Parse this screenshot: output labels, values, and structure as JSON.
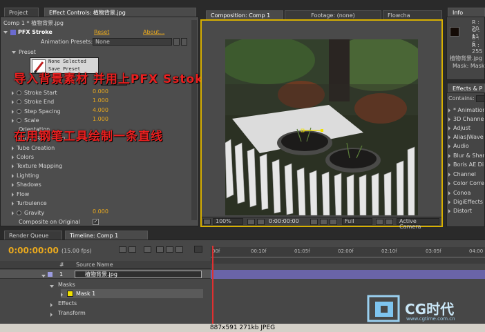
{
  "left_panel": {
    "tabs": [
      "Project",
      "Effect Controls: 植物背景.jpg"
    ],
    "comp_line": "Comp 1 * 植物背景.jpg",
    "effect_name": "PFX Stroke",
    "reset_label": "Reset",
    "about_label": "About...",
    "anim_presets_label": "Animation Presets:",
    "anim_presets_value": "None",
    "preset_label": "Preset",
    "preset_none": "None Selected",
    "preset_save": "Save Preset",
    "params": [
      {
        "label": "Stroke Start",
        "value": "0.000"
      },
      {
        "label": "Stroke End",
        "value": "1.000"
      },
      {
        "label": "Step Spacing",
        "value": "4.000"
      },
      {
        "label": "Scale",
        "value": "1.000"
      }
    ],
    "partial_rows": [
      "Orientation",
      "Brush Resolution"
    ],
    "groups": [
      "Tube Creation",
      "Colors",
      "Texture Mapping",
      "Lighting",
      "Shadows",
      "Flow",
      "Turbulence"
    ],
    "gravity_label": "Gravity",
    "gravity_value": "0.000",
    "composite_label": "Composite on Original"
  },
  "annotations": {
    "line1": "导入背景素材 并用上PFX Sstoke",
    "line2": "在用钢笔工具绘制一条直线"
  },
  "center_panel": {
    "tabs": [
      "Composition: Comp 1",
      "Footage: (none)",
      "Flowcha"
    ],
    "zoom": "100%",
    "timecode": "0:00:00:00",
    "resolution": "Full",
    "camera": "Active Camera"
  },
  "info_panel": {
    "tab": "Info",
    "r": "R : 20",
    "g": "G : 11",
    "b": "B : 6",
    "a": "A : 255",
    "filename": "植物背景.jpg",
    "mask_pos": "Mask: Mask",
    "swatch_color": "#140b06"
  },
  "effects_panel": {
    "tab": "Effects & P",
    "contains_label": "Contains:",
    "items": [
      "* Animation",
      "3D Channel",
      "Adjust",
      "Alias|Wave",
      "Audio",
      "Blur & Sharp",
      "Boris AE Di",
      "Channel",
      "Color Corre",
      "Conoa",
      "DigiEffects",
      "Distort"
    ]
  },
  "timeline": {
    "tabs": [
      "Render Queue",
      "Timeline: Comp 1"
    ],
    "timecode": "0:00:00:00",
    "fps": "(15.00 fps)",
    "col_hash": "#",
    "col_source": "Source Name",
    "layer_num": "1",
    "layer_name": "植物背景.jpg",
    "masks_label": "Masks",
    "mask1": "Mask 1",
    "effects_label": "Effects",
    "transform_label": "Transform",
    "ruler": [
      "00f",
      "00:10f",
      "01:05f",
      "02:00f",
      "02:10f",
      "03:05f",
      "04:00"
    ]
  },
  "watermark": {
    "logo_text": "CG时代",
    "url": "www.cgtime.com.cn"
  },
  "status_bar": "887x591  271kb  JPEG",
  "colors": {
    "accent": "#e8a81e",
    "annotation": "#e82020",
    "layer_bar": "#6a64a8",
    "mask_swatch": "#f0e000",
    "comp_border": "#d8b000"
  }
}
